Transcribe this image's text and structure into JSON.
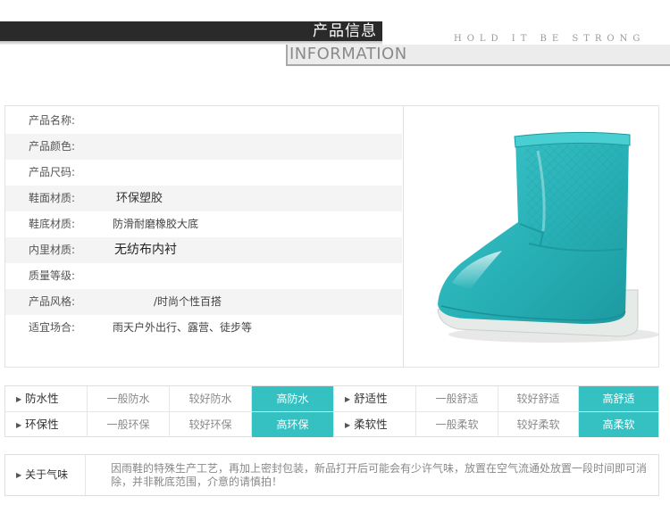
{
  "header": {
    "title": "产品信息",
    "slogan": "HOLD IT BE STRONG",
    "subtitle": "INFORMATION"
  },
  "specs": [
    {
      "label": "产品名称:",
      "value": ""
    },
    {
      "label": "产品颜色:",
      "value": ""
    },
    {
      "label": "产品尺码:",
      "value": ""
    },
    {
      "label": "鞋面材质:",
      "value": "环保塑胶"
    },
    {
      "label": "鞋底材质:",
      "value": "防滑耐磨橡胶大底"
    },
    {
      "label": "内里材质:",
      "value": "无纺布内衬"
    },
    {
      "label": "质量等级:",
      "value": ""
    },
    {
      "label": "产品风格:",
      "value": "/时尚个性百搭"
    },
    {
      "label": "适宜场合:",
      "value": "雨天户外出行、露营、徒步等"
    }
  ],
  "ratings": {
    "rows": [
      [
        {
          "title": "防水性",
          "levels": [
            "一般防水",
            "较好防水",
            "高防水"
          ],
          "selected": 2
        },
        {
          "title": "舒适性",
          "levels": [
            "一般舒适",
            "较好舒适",
            "高舒适"
          ],
          "selected": 2
        }
      ],
      [
        {
          "title": "环保性",
          "levels": [
            "一般环保",
            "较好环保",
            "高环保"
          ],
          "selected": 2
        },
        {
          "title": "柔软性",
          "levels": [
            "一般柔软",
            "较好柔软",
            "高柔软"
          ],
          "selected": 2
        }
      ]
    ]
  },
  "note": {
    "title": "关于气味",
    "text": "因雨鞋的特殊生产工艺，再加上密封包装，新品打开后可能会有少许气味，放置在空气流通处放置一段时间即可消除，并非靴底范围，介意的请慎拍！"
  },
  "colors": {
    "accent": "#35c1c2",
    "boot": "#2bb2b8",
    "header_bar": "#2a2a2a"
  },
  "icons": {
    "bullet": "triangle-right-icon"
  }
}
